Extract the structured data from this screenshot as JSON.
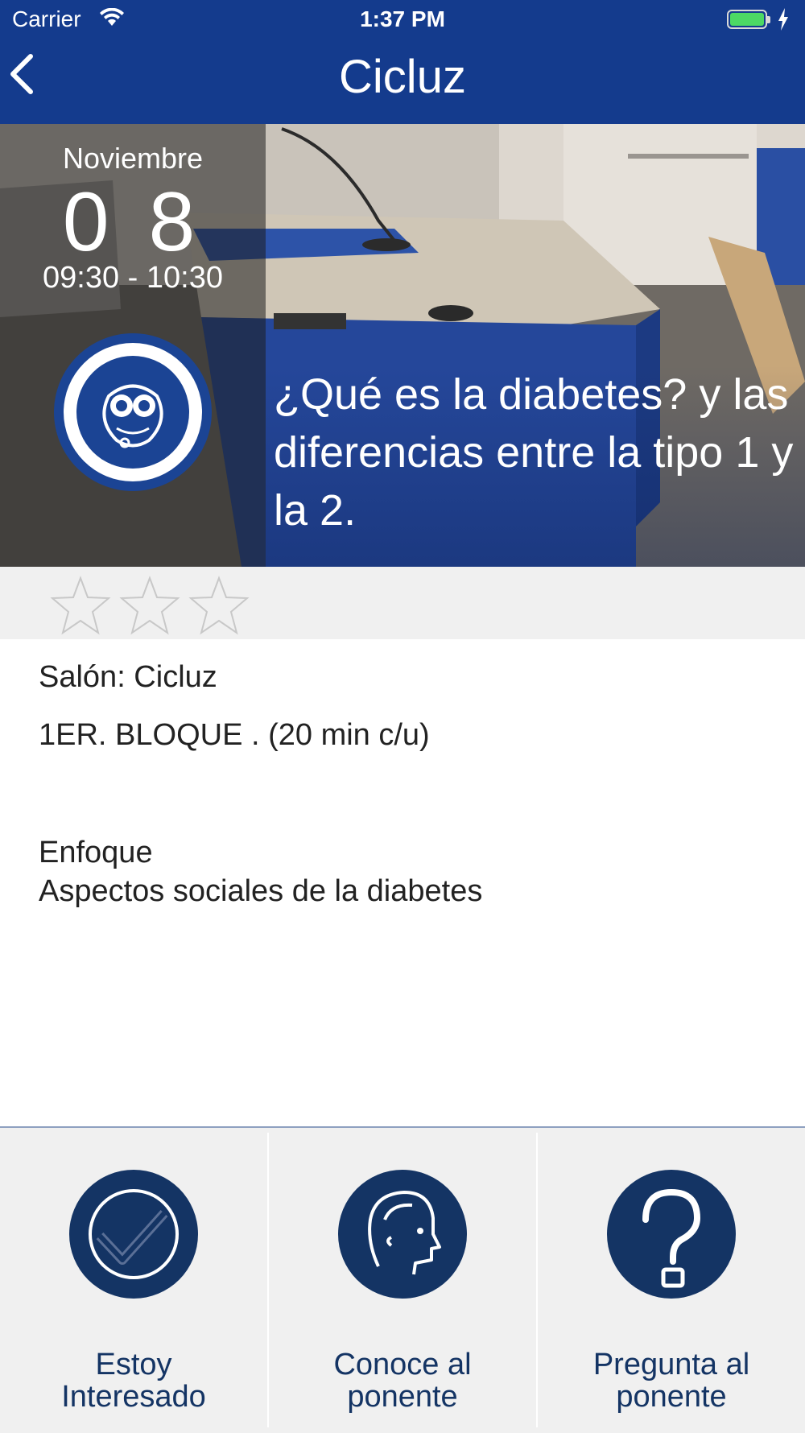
{
  "status": {
    "carrier": "Carrier",
    "time": "1:37 PM"
  },
  "nav": {
    "title": "Cicluz"
  },
  "event": {
    "month": "Noviembre",
    "day": "0 8",
    "hours": "09:30 - 10:30",
    "title": "¿Qué es la diabetes? y las diferencias entre la tipo 1 y la 2."
  },
  "rating": {
    "value": 0,
    "max": 3
  },
  "details": {
    "room": "Salón: Cicluz",
    "block": "1ER. BLOQUE .  (20 min c/u)",
    "focus_label": "Enfoque",
    "focus_value": "Aspectos sociales de la diabetes"
  },
  "actions": [
    {
      "line1": "Estoy",
      "line2": "Interesado",
      "icon": "check-icon"
    },
    {
      "line1": "Conoce al",
      "line2": "ponente",
      "icon": "speaker-head-icon"
    },
    {
      "line1": "Pregunta al",
      "line2": "ponente",
      "icon": "question-icon"
    }
  ],
  "colors": {
    "nav": "#143b8d",
    "action": "#143464",
    "battery": "#4cd964"
  }
}
